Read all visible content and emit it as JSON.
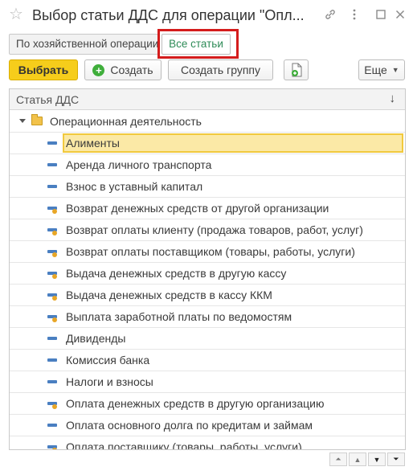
{
  "window": {
    "title": "Выбор статьи ДДС для операции \"Опл...",
    "favorite_icon": "star-icon",
    "link_icon": "link-icon",
    "more_icon": "kebab-menu-icon",
    "maximize_icon": "maximize-icon",
    "close_icon": "close-icon"
  },
  "tabs": [
    {
      "label": "По хозяйственной операции",
      "active": false
    },
    {
      "label": "Все статьи",
      "active": true
    }
  ],
  "toolbar": {
    "select_label": "Выбрать",
    "create_label": "Создать",
    "create_group_label": "Создать группу",
    "more_label": "Еще"
  },
  "table": {
    "column_header": "Статья ДДС",
    "sort_icon": "↓",
    "group": {
      "label": "Операционная деятельность"
    },
    "rows": [
      {
        "label": "Алименты",
        "selected": true,
        "icon": "item"
      },
      {
        "label": "Аренда личного транспорта",
        "icon": "item"
      },
      {
        "label": "Взнос в уставный капитал",
        "icon": "item"
      },
      {
        "label": "Возврат денежных средств от другой организации",
        "icon": "item-dot"
      },
      {
        "label": "Возврат оплаты клиенту (продажа товаров, работ, услуг)",
        "icon": "item-dot"
      },
      {
        "label": "Возврат оплаты поставщиком (товары, работы, услуги)",
        "icon": "item-dot"
      },
      {
        "label": "Выдача денежных средств в другую кассу",
        "icon": "item-dot"
      },
      {
        "label": "Выдача денежных средств в кассу ККМ",
        "icon": "item-dot"
      },
      {
        "label": "Выплата заработной платы по ведомостям",
        "icon": "item-dot"
      },
      {
        "label": "Дивиденды",
        "icon": "item"
      },
      {
        "label": "Комиссия банка",
        "icon": "item"
      },
      {
        "label": "Налоги и взносы",
        "icon": "item"
      },
      {
        "label": "Оплата денежных средств в другую организацию",
        "icon": "item-dot"
      },
      {
        "label": "Оплата основного долга по кредитам и займам",
        "icon": "item"
      },
      {
        "label": "Оплата поставщику (товары, работы, услуги)",
        "icon": "item-dot"
      }
    ]
  },
  "colors": {
    "primary_button": "#f6cd1b",
    "active_tab_text": "#2e8b57",
    "highlight_frame": "#d41c1c",
    "selected_row": "#fbe9a6"
  }
}
